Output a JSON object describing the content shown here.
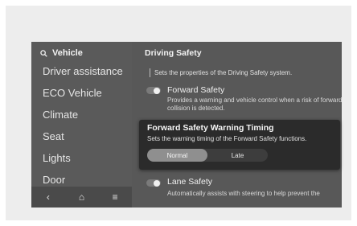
{
  "sidebar": {
    "search_label": "Vehicle",
    "items": [
      {
        "label": "Driver assistance"
      },
      {
        "label": "ECO Vehicle"
      },
      {
        "label": "Climate"
      },
      {
        "label": "Seat"
      },
      {
        "label": "Lights"
      },
      {
        "label": "Door"
      }
    ],
    "bottom_nav": {
      "back_glyph": "‹",
      "home_glyph": "⌂",
      "menu_glyph": "≡"
    }
  },
  "main": {
    "title": "Driving Safety",
    "description": "Sets the properties of the Driving Safety system.",
    "settings": [
      {
        "title": "Forward Safety",
        "desc": "Provides a warning and vehicle control when a risk of forward collision is detected.",
        "toggle_on": false
      },
      {
        "title": "Lane Safety",
        "desc": "Automatically assists with steering to help prevent the",
        "toggle_on": false
      }
    ]
  },
  "popup": {
    "title": "Forward Safety Warning Timing",
    "desc": "Sets the warning timing of the Forward Safety functions.",
    "options": [
      "Normal",
      "Late"
    ],
    "selected": "Normal"
  },
  "icons": [
    "search-icon",
    "back-icon",
    "home-icon",
    "menu-icon",
    "toggle-icon"
  ]
}
